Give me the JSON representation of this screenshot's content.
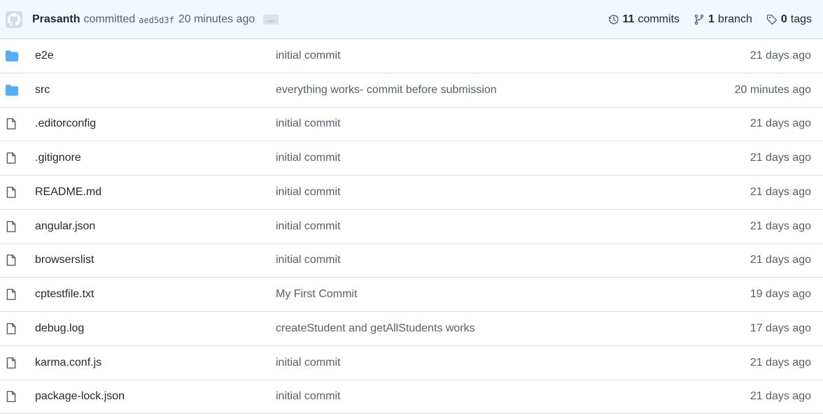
{
  "commit": {
    "author": "Prasanth",
    "verb": "committed",
    "sha": "aed5d3f",
    "time": "20 minutes ago",
    "ellipsis": "…"
  },
  "stats": {
    "commits_count": "11",
    "commits_label": "commits",
    "branch_count": "1",
    "branch_label": "branch",
    "tags_count": "0",
    "tags_label": "tags"
  },
  "colors": {
    "folder": "#54aeff",
    "file": "#57606a",
    "header_bg": "#f1f8ff"
  },
  "files": [
    {
      "type": "folder",
      "icon": "folder-icon",
      "name": "e2e",
      "message": "initial commit",
      "age": "21 days ago"
    },
    {
      "type": "folder",
      "icon": "folder-icon",
      "name": "src",
      "message": "everything works- commit before submission",
      "age": "20 minutes ago"
    },
    {
      "type": "file",
      "icon": "file-icon",
      "name": ".editorconfig",
      "message": "initial commit",
      "age": "21 days ago"
    },
    {
      "type": "file",
      "icon": "file-icon",
      "name": ".gitignore",
      "message": "initial commit",
      "age": "21 days ago"
    },
    {
      "type": "file",
      "icon": "file-icon",
      "name": "README.md",
      "message": "initial commit",
      "age": "21 days ago"
    },
    {
      "type": "file",
      "icon": "file-icon",
      "name": "angular.json",
      "message": "initial commit",
      "age": "21 days ago"
    },
    {
      "type": "file",
      "icon": "file-icon",
      "name": "browserslist",
      "message": "initial commit",
      "age": "21 days ago"
    },
    {
      "type": "file",
      "icon": "file-icon",
      "name": "cptestfile.txt",
      "message": "My First Commit",
      "age": "19 days ago"
    },
    {
      "type": "file",
      "icon": "file-icon",
      "name": "debug.log",
      "message": "createStudent and getAllStudents works",
      "age": "17 days ago"
    },
    {
      "type": "file",
      "icon": "file-icon",
      "name": "karma.conf.js",
      "message": "initial commit",
      "age": "21 days ago"
    },
    {
      "type": "file",
      "icon": "file-icon",
      "name": "package-lock.json",
      "message": "initial commit",
      "age": "21 days ago"
    }
  ]
}
